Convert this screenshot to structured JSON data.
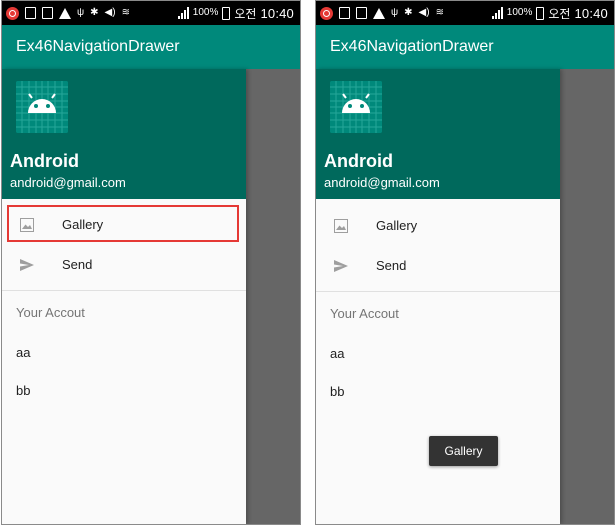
{
  "status_bar": {
    "battery": "100%",
    "ampm": "오전",
    "time": "10:40"
  },
  "app": {
    "title": "Ex46NavigationDrawer"
  },
  "drawer": {
    "name": "Android",
    "email": "android@gmail.com",
    "menu": [
      {
        "label": "Gallery",
        "icon": "gallery-icon"
      },
      {
        "label": "Send",
        "icon": "send-icon"
      }
    ],
    "section_title": "Your Accout",
    "section_items": [
      "aa",
      "bb"
    ]
  },
  "toast": {
    "message": "Gallery"
  },
  "colors": {
    "appbar": "#00897b",
    "drawer_header": "#00695c",
    "scrim": "#666666",
    "highlight": "#e53935"
  }
}
